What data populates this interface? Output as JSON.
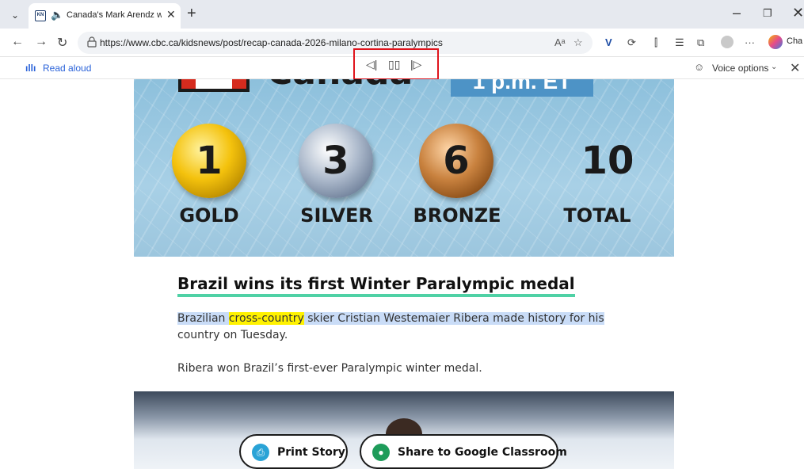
{
  "browser": {
    "tab": {
      "favicon_text": "KN",
      "title": "Canada's Mark Arendz wins hi"
    },
    "url": "https://www.cbc.ca/kidsnews/post/recap-canada-2026-milano-cortina-paralympics",
    "copilot_label": "Cha"
  },
  "read_aloud": {
    "label": "Read aloud",
    "voice_options_label": "Voice options",
    "controls": {
      "previous": "◁|",
      "pause": "▯▯",
      "next": "|▷"
    }
  },
  "medal_graphic": {
    "country": "Canada",
    "time_badge": "1 p.m. ET",
    "medals": [
      {
        "label": "GOLD",
        "count": "1"
      },
      {
        "label": "SILVER",
        "count": "3"
      },
      {
        "label": "BRONZE",
        "count": "6"
      },
      {
        "label": "TOTAL",
        "count": "10"
      }
    ]
  },
  "article": {
    "headline": "Brazil wins its first Winter Paralympic medal",
    "para1_before": "Brazilian ",
    "para1_highlight": "cross-country",
    "para1_after": " skier Cristian Westemaier Ribera made history for his",
    "para1_line2": "country on Tuesday.",
    "para2": "Ribera won Brazil’s first-ever Paralympic winter medal."
  },
  "buttons": {
    "print_story": "Print Story",
    "share_classroom": "Share to Google Classroom"
  }
}
